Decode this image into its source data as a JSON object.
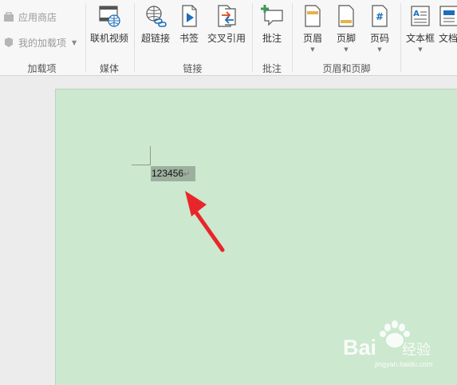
{
  "ribbon": {
    "addins": {
      "app_store_label": "应用商店",
      "my_addins_label": "我的加载项",
      "group_label": "加载项"
    },
    "media": {
      "online_video_label": "联机视频",
      "group_label": "媒体"
    },
    "links": {
      "hyperlink_label": "超链接",
      "bookmark_label": "书签",
      "cross_ref_label": "交叉引用",
      "group_label": "链接"
    },
    "comments": {
      "comment_label": "批注",
      "group_label": "批注"
    },
    "header_footer": {
      "header_label": "页眉",
      "footer_label": "页脚",
      "page_number_label": "页码",
      "group_label": "页眉和页脚"
    },
    "text": {
      "textbox_label": "文本框",
      "doc_parts_label": "文档"
    }
  },
  "document": {
    "selected_text": "123456",
    "paragraph_mark": "↵"
  },
  "watermark": {
    "brand": "Bai",
    "brand_cn": "经验",
    "url": "jingyan.baidu.com"
  },
  "colors": {
    "page_background": "#cce8cf",
    "selection_highlight": "#9db09f",
    "annotation_arrow": "#e8262a"
  }
}
